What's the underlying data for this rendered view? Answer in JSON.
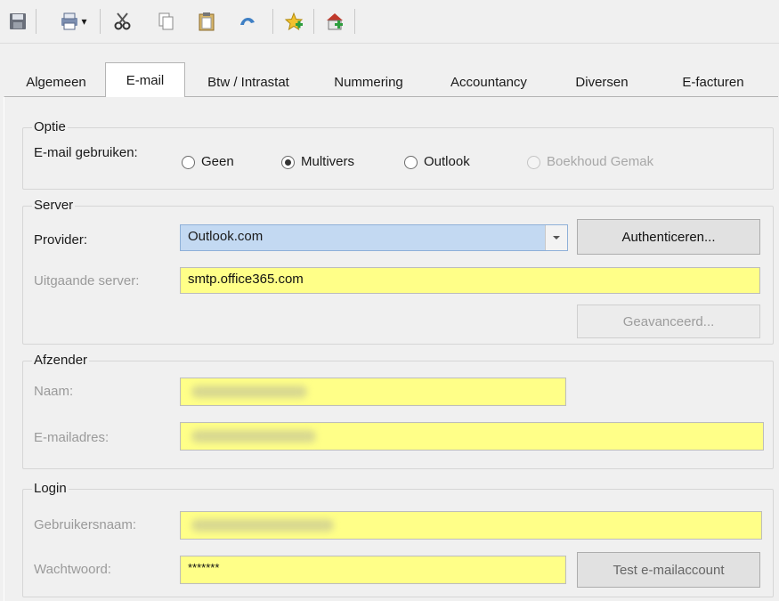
{
  "toolbar": {
    "icons": [
      "save-icon",
      "print-icon",
      "cut-icon",
      "copy-icon",
      "paste-icon",
      "undo-icon",
      "favorite-icon",
      "home-add-icon"
    ],
    "dropdown_caret": "▾"
  },
  "tabs": [
    {
      "label": "Algemeen",
      "active": false
    },
    {
      "label": "E-mail",
      "active": true
    },
    {
      "label": "Btw / Intrastat",
      "active": false
    },
    {
      "label": "Nummering",
      "active": false
    },
    {
      "label": "Accountancy",
      "active": false
    },
    {
      "label": "Diversen",
      "active": false
    },
    {
      "label": "E-facturen",
      "active": false
    }
  ],
  "optie": {
    "legend": "Optie",
    "label": "E-mail gebruiken:",
    "options": [
      {
        "label": "Geen",
        "checked": false,
        "disabled": false
      },
      {
        "label": "Multivers",
        "checked": true,
        "disabled": false
      },
      {
        "label": "Outlook",
        "checked": false,
        "disabled": false
      },
      {
        "label": "Boekhoud Gemak",
        "checked": false,
        "disabled": true
      }
    ]
  },
  "server": {
    "legend": "Server",
    "provider_label": "Provider:",
    "provider_value": "Outlook.com",
    "authenticate_button": "Authenticeren...",
    "outgoing_label": "Uitgaande server:",
    "outgoing_value": "smtp.office365.com",
    "advanced_button": "Geavanceerd..."
  },
  "afzender": {
    "legend": "Afzender",
    "name_label": "Naam:",
    "email_label": "E-mailadres:"
  },
  "login": {
    "legend": "Login",
    "username_label": "Gebruikersnaam:",
    "password_label": "Wachtwoord:",
    "password_value": "*******",
    "test_button": "Test e-mailaccount"
  },
  "colors": {
    "field_highlight": "#ffff88",
    "combo_selected": "#c3d9f2"
  }
}
